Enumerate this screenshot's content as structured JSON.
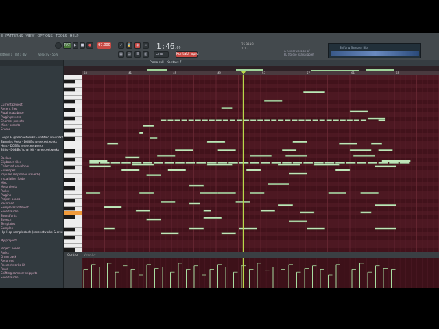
{
  "menu": [
    "E",
    "PATTERNS",
    "VIEW",
    "OPTIONS",
    "TOOLS",
    "HELP"
  ],
  "transport": {
    "pat_label": "PAT",
    "song_label": "SONG",
    "tempo_display": "97.000",
    "time_main": "1:46",
    "time_sub": ":09"
  },
  "hint_text": "Pattern 1 | Bit 1 dly",
  "velocity_label": "Velocity - 56%",
  "mixer": {
    "line1": "25   99 kB",
    "line2": "1:1   7"
  },
  "news": {
    "line1": "A newer version of",
    "line2": "FL Studio is available!"
  },
  "monitor": {
    "title": "Shifting Sampler Bits"
  },
  "channel_select": "Kontakt_sprd",
  "mode_select": "Line",
  "browser": {
    "items": [
      {
        "label": "",
        "style": "p"
      },
      {
        "label": "",
        "style": "p"
      },
      {
        "label": "",
        "style": "p"
      },
      {
        "label": "",
        "style": "p"
      },
      {
        "label": "",
        "style": "p"
      },
      {
        "label": "",
        "style": "p"
      },
      {
        "label": "",
        "style": "p"
      },
      {
        "label": "",
        "style": "p"
      },
      {
        "label": "",
        "style": "p"
      },
      {
        "label": "Current project",
        "style": "p"
      },
      {
        "label": "Recent files",
        "style": "p"
      },
      {
        "label": "Plugin database",
        "style": "p"
      },
      {
        "label": "Plugin presets",
        "style": "p"
      },
      {
        "label": "Channel presets",
        "style": "p"
      },
      {
        "label": "Mixer presets",
        "style": "p"
      },
      {
        "label": "Scores",
        "style": "p"
      },
      {
        "label": "",
        "style": "p"
      },
      {
        "label": "Loops & @reeceetworks - untitled (soundkit) (1)",
        "style": "w"
      },
      {
        "label": "Samples Meta - DOBBs @reeceetworks",
        "style": "w"
      },
      {
        "label": "Hats - DOBBs @reeceetworks",
        "style": "w"
      },
      {
        "label": "808s - DOBBs 'tchat kit - @reeceetworks",
        "style": "w"
      },
      {
        "label": "",
        "style": "p"
      },
      {
        "label": "Backup",
        "style": "p"
      },
      {
        "label": "Clipboard files",
        "style": "p"
      },
      {
        "label": "Collected envelopes",
        "style": "p"
      },
      {
        "label": "Envelopes",
        "style": "p"
      },
      {
        "label": "Impulse responses (reverb)",
        "style": "p"
      },
      {
        "label": "Installation folder",
        "style": "p"
      },
      {
        "label": "Misc",
        "style": "p"
      },
      {
        "label": "My projects",
        "style": "p"
      },
      {
        "label": "Packs",
        "style": "p"
      },
      {
        "label": "Plugins",
        "style": "p"
      },
      {
        "label": "Project bones",
        "style": "p"
      },
      {
        "label": "Recorded",
        "style": "p"
      },
      {
        "label": "Sample assortment",
        "style": "p"
      },
      {
        "label": "Sliced audio",
        "style": "p"
      },
      {
        "label": "Soundfonts",
        "style": "p"
      },
      {
        "label": "Speech",
        "style": "p"
      },
      {
        "label": "Templates",
        "style": "p"
      },
      {
        "label": "Samples",
        "style": "p"
      },
      {
        "label": "Hip Hop samplestash (reeceetworks & creatorz)",
        "style": "w"
      },
      {
        "label": "",
        "style": "p"
      },
      {
        "label": "My projects",
        "style": "p"
      },
      {
        "label": "",
        "style": "p"
      },
      {
        "label": "Project bones",
        "style": "p"
      },
      {
        "label": "Packs",
        "style": "p"
      },
      {
        "label": "Drum pack",
        "style": "p"
      },
      {
        "label": "Recorded",
        "style": "p"
      },
      {
        "label": "Reeceetworks kit",
        "style": "p"
      },
      {
        "label": "Rend",
        "style": "p"
      },
      {
        "label": "Shifting sampler snippets",
        "style": "p"
      },
      {
        "label": "Sliced audio",
        "style": "p"
      }
    ]
  },
  "piano_roll": {
    "title": "Piano roll - Kontakt 7",
    "bar_numbers": [
      "33",
      "",
      "41",
      "",
      "45",
      "",
      "49",
      "",
      "53",
      "",
      "57",
      "",
      "61",
      "",
      "65",
      "",
      "69",
      ""
    ],
    "control_label": "Control",
    "velocity_label": "Velocity",
    "playhead_fraction": 0.451,
    "notes": [
      [
        0.62,
        0.09,
        0.06,
        0.09
      ],
      [
        0.51,
        0.14,
        0.05,
        0.05
      ],
      [
        0.39,
        0.18,
        0.03,
        0.04
      ],
      [
        0.75,
        0.2,
        0.05,
        0.05
      ],
      [
        0.8,
        0.24,
        0.05,
        0.03
      ],
      [
        0.83,
        0.25,
        0.02,
        0.03
      ],
      [
        0.22,
        0.25,
        0.58,
        0.0
      ],
      [
        0.17,
        0.28,
        0.03,
        0.04
      ],
      [
        0.16,
        0.32,
        0.01,
        0.02
      ],
      [
        0.19,
        0.35,
        0.02,
        0.03
      ],
      [
        0.07,
        0.38,
        0.03,
        0.02
      ],
      [
        0.35,
        0.37,
        0.05,
        0.04
      ],
      [
        0.59,
        0.37,
        0.04,
        0.05
      ],
      [
        0.72,
        0.38,
        0.05,
        0.03
      ],
      [
        0.81,
        0.38,
        0.03,
        0.05
      ],
      [
        0.38,
        0.42,
        0.05,
        0.04
      ],
      [
        0.26,
        0.42,
        0.05,
        0.03
      ],
      [
        0.56,
        0.42,
        0.04,
        0.02
      ],
      [
        0.75,
        0.42,
        0.06,
        0.05
      ],
      [
        0.83,
        0.42,
        0.04,
        0.03
      ],
      [
        0.21,
        0.45,
        0.05,
        0.07
      ],
      [
        0.47,
        0.45,
        0.06,
        0.03
      ],
      [
        0.57,
        0.45,
        0.06,
        0.05
      ],
      [
        0.76,
        0.45,
        0.06,
        0.05
      ],
      [
        0.12,
        0.46,
        0.04,
        0.05
      ],
      [
        0.02,
        0.48,
        0.05,
        0.04
      ],
      [
        0.84,
        0.48,
        0.08,
        0.04
      ],
      [
        0.02,
        0.49,
        0.9,
        0.0
      ],
      [
        0.02,
        0.51,
        0.06,
        0.04
      ],
      [
        0.14,
        0.5,
        0.06,
        0.04
      ],
      [
        0.35,
        0.5,
        0.07,
        0.04
      ],
      [
        0.55,
        0.5,
        0.06,
        0.03
      ],
      [
        0.65,
        0.5,
        0.07,
        0.04
      ],
      [
        0.82,
        0.51,
        0.06,
        0.04
      ],
      [
        0.11,
        0.53,
        0.05,
        0.03
      ],
      [
        0.24,
        0.53,
        0.05,
        0.03
      ],
      [
        0.46,
        0.53,
        0.04,
        0.03
      ],
      [
        0.71,
        0.53,
        0.04,
        0.04
      ],
      [
        0.18,
        0.56,
        0.04,
        0.03
      ],
      [
        0.58,
        0.55,
        0.05,
        0.04
      ],
      [
        0.52,
        0.61,
        0.06,
        0.03
      ],
      [
        0.3,
        0.62,
        0.04,
        0.03
      ],
      [
        0.33,
        0.66,
        0.05,
        0.03
      ],
      [
        0.16,
        0.66,
        0.04,
        0.04
      ],
      [
        0.01,
        0.66,
        0.04,
        0.03
      ],
      [
        0.38,
        0.66,
        0.05,
        0.04
      ],
      [
        0.47,
        0.66,
        0.04,
        0.03
      ],
      [
        0.69,
        0.66,
        0.05,
        0.04
      ],
      [
        0.78,
        0.66,
        0.05,
        0.04
      ],
      [
        0.22,
        0.71,
        0.04,
        0.04
      ],
      [
        0.3,
        0.72,
        0.03,
        0.04
      ],
      [
        0.43,
        0.71,
        0.04,
        0.04
      ],
      [
        0.55,
        0.73,
        0.04,
        0.03
      ],
      [
        0.82,
        0.73,
        0.06,
        0.04
      ],
      [
        0.06,
        0.74,
        0.05,
        0.04
      ],
      [
        0.15,
        0.76,
        0.04,
        0.04
      ],
      [
        0.34,
        0.76,
        0.02,
        0.03
      ],
      [
        0.5,
        0.76,
        0.04,
        0.03
      ],
      [
        0.61,
        0.77,
        0.04,
        0.04
      ],
      [
        0.78,
        0.77,
        0.03,
        0.04
      ],
      [
        0.18,
        0.81,
        0.04,
        0.04
      ],
      [
        0.34,
        0.8,
        0.05,
        0.04
      ],
      [
        0.58,
        0.82,
        0.05,
        0.04
      ],
      [
        0.06,
        0.86,
        0.03,
        0.05
      ],
      [
        0.3,
        0.86,
        0.04,
        0.04
      ],
      [
        0.44,
        0.86,
        0.05,
        0.04
      ],
      [
        0.63,
        0.86,
        0.05,
        0.05
      ],
      [
        0.82,
        0.86,
        0.06,
        0.04
      ],
      [
        0.22,
        0.89,
        0.05,
        0.03
      ],
      [
        0.39,
        0.89,
        0.04,
        0.04
      ]
    ],
    "velocities": [
      0.7,
      0.9,
      0.8,
      0.95,
      0.6,
      0.85,
      0.7,
      0.5,
      0.9,
      0.75,
      0.8,
      0.6,
      0.95,
      0.7,
      0.85,
      0.5,
      0.7,
      0.9,
      0.8,
      0.6,
      0.85,
      0.7,
      0.95,
      0.65,
      0.8,
      0.7,
      0.9,
      0.6,
      0.75,
      0.85,
      0.7,
      0.5,
      0.9,
      0.8,
      0.7,
      0.95,
      0.6,
      0.85,
      0.75,
      0.7
    ]
  }
}
